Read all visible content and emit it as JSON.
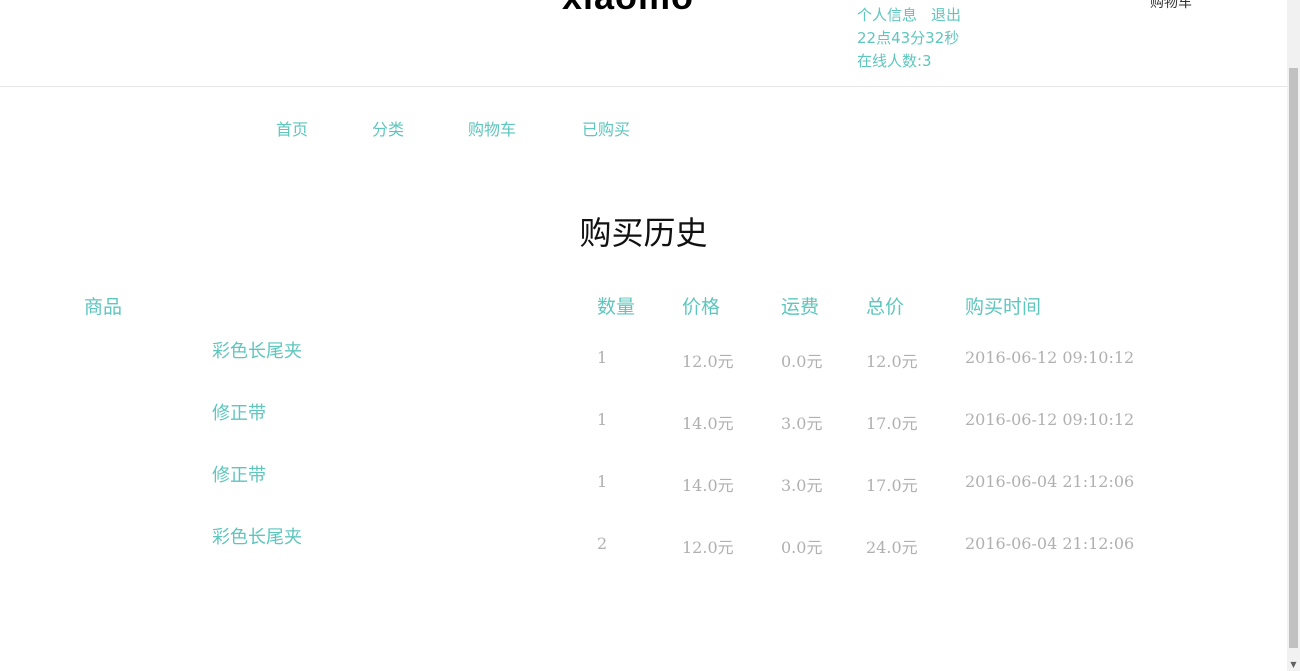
{
  "header": {
    "logo": "xiaomo",
    "user_links": [
      "个人信息",
      "退出"
    ],
    "clock": "22点43分32秒",
    "online_users": "在线人数:3",
    "cart_label": "购物车"
  },
  "nav": {
    "items": [
      "首页",
      "分类",
      "购物车",
      "已购买"
    ]
  },
  "page": {
    "title": "购买历史"
  },
  "table": {
    "headers": {
      "product": "商品",
      "qty": "数量",
      "price": "价格",
      "shipping": "运费",
      "total": "总价",
      "time": "购买时间"
    },
    "rows": [
      {
        "name": "彩色长尾夹",
        "qty": "1",
        "price": "12.0元",
        "shipping": "0.0元",
        "total": "12.0元",
        "time": "2016-06-12 09:10:12"
      },
      {
        "name": "修正带",
        "qty": "1",
        "price": "14.0元",
        "shipping": "3.0元",
        "total": "17.0元",
        "time": "2016-06-12 09:10:12"
      },
      {
        "name": "修正带",
        "qty": "1",
        "price": "14.0元",
        "shipping": "3.0元",
        "total": "17.0元",
        "time": "2016-06-04 21:12:06"
      },
      {
        "name": "彩色长尾夹",
        "qty": "2",
        "price": "12.0元",
        "shipping": "0.0元",
        "total": "24.0元",
        "time": "2016-06-04 21:12:06"
      }
    ]
  }
}
